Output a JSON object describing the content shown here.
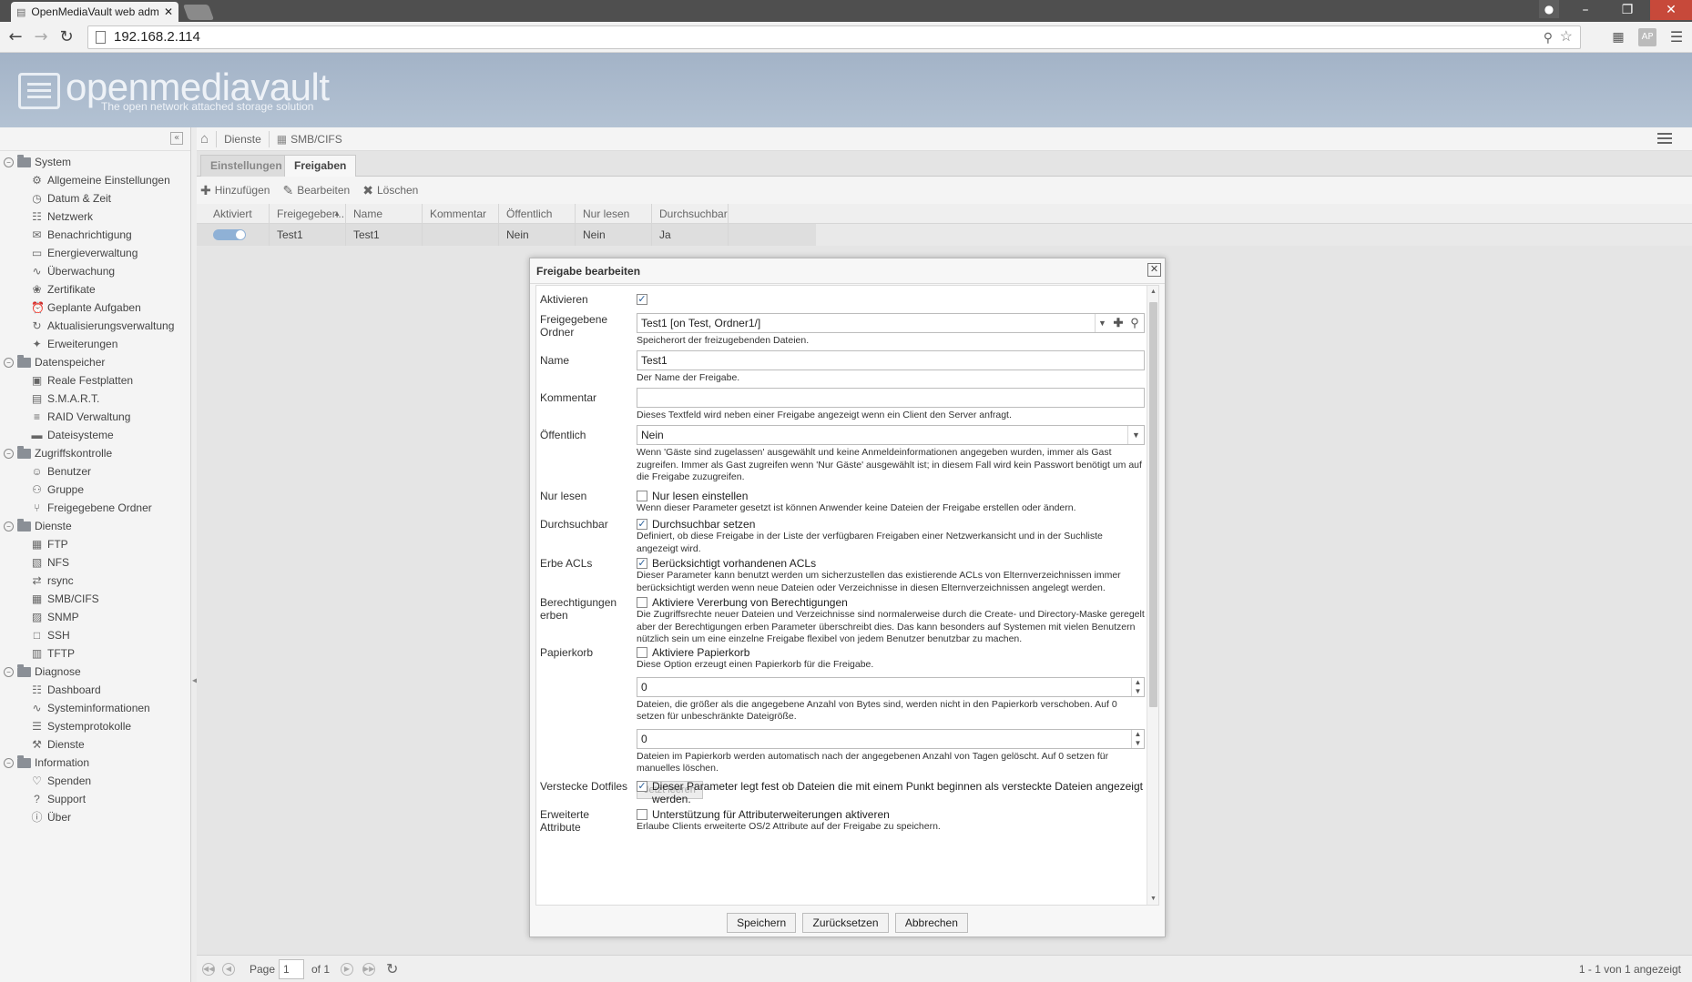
{
  "browser": {
    "tab_title": "OpenMediaVault web adm",
    "url": "192.168.2.114"
  },
  "header": {
    "logo_text": "openmediavault",
    "tagline": "The open network attached storage solution"
  },
  "nav": {
    "groups": [
      {
        "label": "System",
        "items": [
          {
            "label": "Allgemeine Einstellungen",
            "icon": "gears-icon"
          },
          {
            "label": "Datum & Zeit",
            "icon": "clock-icon"
          },
          {
            "label": "Netzwerk",
            "icon": "network-icon"
          },
          {
            "label": "Benachrichtigung",
            "icon": "envelope-icon"
          },
          {
            "label": "Energieverwaltung",
            "icon": "battery-icon"
          },
          {
            "label": "Überwachung",
            "icon": "chart-line-icon"
          },
          {
            "label": "Zertifikate",
            "icon": "certificate-icon"
          },
          {
            "label": "Geplante Aufgaben",
            "icon": "alarm-clock-icon"
          },
          {
            "label": "Aktualisierungsverwaltung",
            "icon": "update-icon"
          },
          {
            "label": "Erweiterungen",
            "icon": "puzzle-icon"
          }
        ]
      },
      {
        "label": "Datenspeicher",
        "items": [
          {
            "label": "Reale Festplatten",
            "icon": "harddisk-icon"
          },
          {
            "label": "S.M.A.R.T.",
            "icon": "smart-icon"
          },
          {
            "label": "RAID Verwaltung",
            "icon": "raid-icon"
          },
          {
            "label": "Dateisysteme",
            "icon": "folder-icon"
          }
        ]
      },
      {
        "label": "Zugriffskontrolle",
        "items": [
          {
            "label": "Benutzer",
            "icon": "user-icon"
          },
          {
            "label": "Gruppe",
            "icon": "group-icon"
          },
          {
            "label": "Freigegebene Ordner",
            "icon": "share-icon"
          }
        ]
      },
      {
        "label": "Dienste",
        "items": [
          {
            "label": "FTP",
            "icon": "ftp-icon"
          },
          {
            "label": "NFS",
            "icon": "nfs-icon"
          },
          {
            "label": "rsync",
            "icon": "rsync-icon"
          },
          {
            "label": "SMB/CIFS",
            "icon": "windows-icon"
          },
          {
            "label": "SNMP",
            "icon": "snmp-icon"
          },
          {
            "label": "SSH",
            "icon": "terminal-icon"
          },
          {
            "label": "TFTP",
            "icon": "tftp-icon"
          }
        ]
      },
      {
        "label": "Diagnose",
        "items": [
          {
            "label": "Dashboard",
            "icon": "dashboard-icon"
          },
          {
            "label": "Systeminformationen",
            "icon": "chart-line-icon"
          },
          {
            "label": "Systemprotokolle",
            "icon": "log-icon"
          },
          {
            "label": "Dienste",
            "icon": "wrench-icon"
          }
        ]
      },
      {
        "label": "Information",
        "items": [
          {
            "label": "Spenden",
            "icon": "heart-icon"
          },
          {
            "label": "Support",
            "icon": "question-icon"
          },
          {
            "label": "Über",
            "icon": "info-icon"
          }
        ]
      }
    ]
  },
  "breadcrumb": {
    "home_icon": "home-icon",
    "section": "Dienste",
    "page": "SMB/CIFS"
  },
  "tabs": [
    {
      "label": "Einstellungen",
      "active": false
    },
    {
      "label": "Freigaben",
      "active": true
    }
  ],
  "grid_toolbar": {
    "add": "Hinzufügen",
    "edit": "Bearbeiten",
    "delete": "Löschen"
  },
  "grid": {
    "columns": [
      "Aktiviert",
      "Freigegeben...",
      "Name",
      "Kommentar",
      "Öffentlich",
      "Nur lesen",
      "Durchsuchbar"
    ],
    "rows": [
      {
        "enabled": true,
        "shared_folder": "Test1",
        "name": "Test1",
        "comment": "",
        "public": "Nein",
        "readonly": "Nein",
        "browseable": "Ja"
      }
    ]
  },
  "pager": {
    "page_label": "Page",
    "page_value": "1",
    "of_label": "of 1",
    "summary": "1 - 1 von 1 angezeigt"
  },
  "dialog": {
    "title": "Freigabe bearbeiten",
    "fields": {
      "enable": {
        "label": "Aktivieren",
        "checked": true
      },
      "sharedfolder": {
        "label": "Freigegebene Ordner",
        "value": "Test1 [on Test, Ordner1/]",
        "help": "Speicherort der freizugebenden Dateien."
      },
      "name": {
        "label": "Name",
        "value": "Test1",
        "help": "Der Name der Freigabe."
      },
      "comment": {
        "label": "Kommentar",
        "value": "",
        "help": "Dieses Textfeld wird neben einer Freigabe angezeigt wenn ein Client den Server anfragt."
      },
      "guest": {
        "label": "Öffentlich",
        "value": "Nein",
        "help": "Wenn 'Gäste sind zugelassen' ausgewählt und keine Anmeldeinformationen angegeben wurden, immer als Gast zugreifen. Immer als Gast zugreifen wenn 'Nur Gäste' ausgewählt ist; in diesem Fall wird kein Passwort benötigt um auf die Freigabe zuzugreifen."
      },
      "readonly": {
        "label": "Nur lesen",
        "checkbox_label": "Nur lesen einstellen",
        "checked": false,
        "help": "Wenn dieser Parameter gesetzt ist können Anwender keine Dateien der Freigabe erstellen oder ändern."
      },
      "browseable": {
        "label": "Durchsuchbar",
        "checkbox_label": "Durchsuchbar setzen",
        "checked": true,
        "help": "Definiert, ob diese Freigabe in der Liste der verfügbaren Freigaben einer Netzwerkansicht und in der Suchliste angezeigt wird."
      },
      "inheritacls": {
        "label": "Erbe ACLs",
        "checkbox_label": "Berücksichtigt vorhandenen ACLs",
        "checked": true,
        "help": "Dieser Parameter kann benutzt werden um sicherzustellen das existierende ACLs von Elternverzeichnissen immer berücksichtigt werden wenn neue Dateien oder Verzeichnisse in diesen Elternverzeichnissen angelegt werden."
      },
      "inheritpermissions": {
        "label": "Berechtigungen erben",
        "checkbox_label": "Aktiviere Vererbung von Berechtigungen",
        "checked": false,
        "help": "Die Zugriffsrechte neuer Dateien und Verzeichnisse sind normalerweise durch die Create- und Directory-Maske geregelt aber der Berechtigungen erben Parameter überschreibt dies. Das kann besonders auf Systemen mit vielen Benutzern nützlich sein um eine einzelne Freigabe flexibel von jedem Benutzer benutzbar zu machen."
      },
      "recyclebin": {
        "label": "Papierkorb",
        "checkbox_label": "Aktiviere Papierkorb",
        "checked": false,
        "help": "Diese Option erzeugt einen Papierkorb für die Freigabe.",
        "maxsize": "0",
        "maxsize_help": "Dateien, die größer als die angegebene Anzahl von Bytes sind, werden nicht in den Papierkorb verschoben. Auf 0 setzen für unbeschränkte Dateigröße.",
        "maxage": "0",
        "maxage_help": "Dateien im Papierkorb werden automatisch nach der angegebenen Anzahl von Tagen gelöscht. Auf 0 setzen für manuelles löschen.",
        "purge_button": "Jetzt leeren"
      },
      "hidedotfiles": {
        "label": "Verstecke Dotfiles",
        "checkbox_label": "Dieser Parameter legt fest ob Dateien die mit einem Punkt beginnen als versteckte Dateien angezeigt werden.",
        "checked": true
      },
      "easupport": {
        "label": "Erweiterte Attribute",
        "checkbox_label": "Unterstützung für Attributerweiterungen aktiveren",
        "checked": false,
        "help": "Erlaube Clients erweiterte OS/2 Attribute auf der Freigabe zu speichern."
      }
    },
    "buttons": {
      "save": "Speichern",
      "reset": "Zurücksetzen",
      "cancel": "Abbrechen"
    }
  }
}
